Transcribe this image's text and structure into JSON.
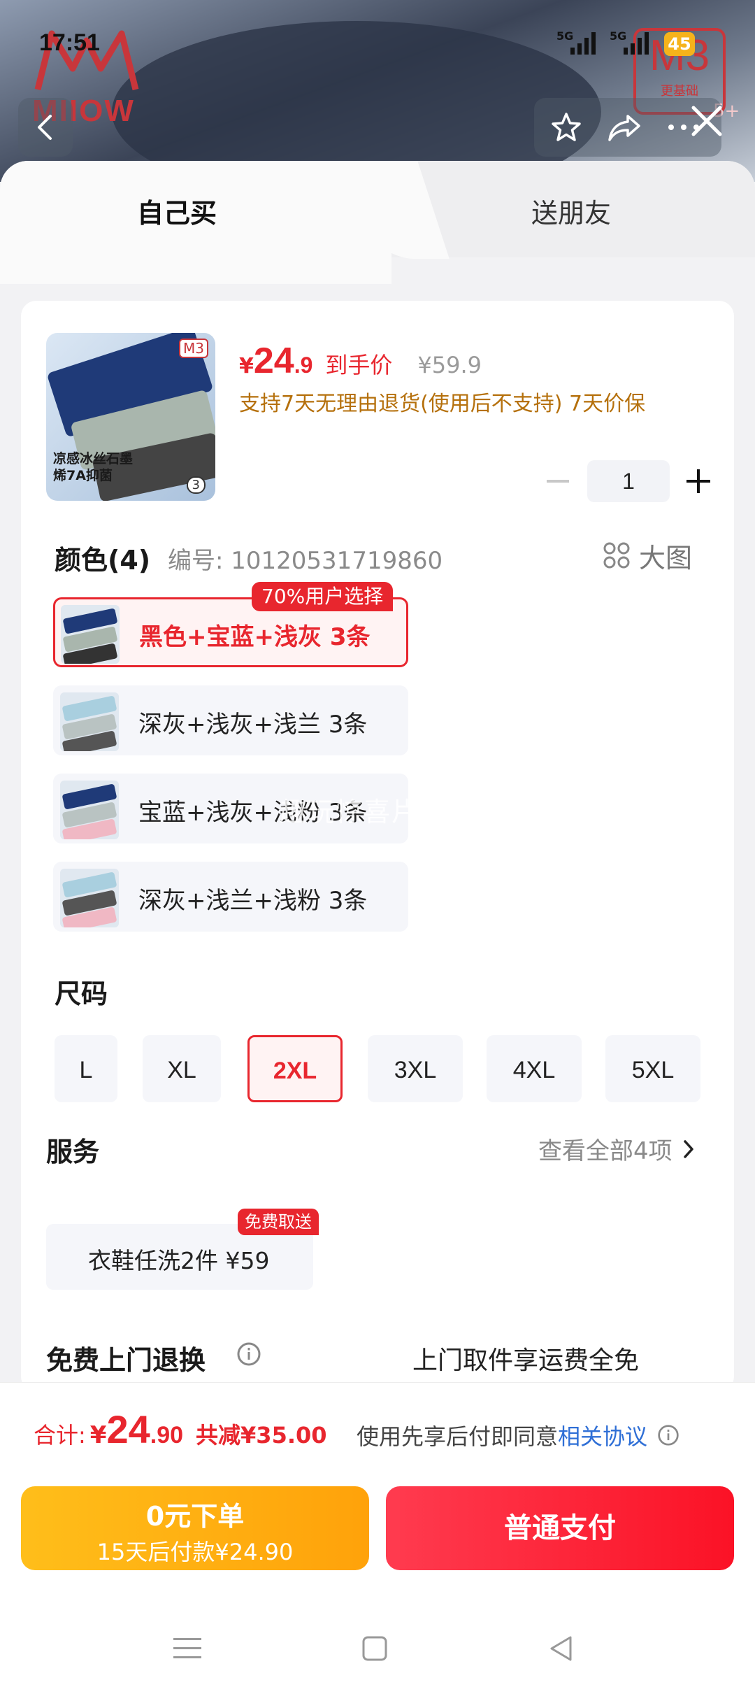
{
  "status_bar": {
    "time": "17:51",
    "signal1": "5G",
    "signal2": "5G",
    "battery": "45"
  },
  "overlay": {
    "brand": "MIIOW",
    "m3_badge": "M3",
    "m3_badge_sub": "更基础",
    "more_badge": "5+",
    "icons": [
      "back-icon",
      "star-icon",
      "share-icon",
      "more-icon",
      "close-icon"
    ]
  },
  "tabs": [
    {
      "label": "自己买",
      "active": true
    },
    {
      "label": "送朋友",
      "active": false
    }
  ],
  "product": {
    "thumb_caption": "凉感冰丝石墨烯7A抑菌",
    "thumb_badge": "M3",
    "thumb_count": "3",
    "price_currency": "¥",
    "price_int": "24",
    "price_dec": ".9",
    "price_label": "到手价",
    "original_price": "¥59.9",
    "promise": "支持7天无理由退货(使用后不支持) 7天价保",
    "quantity": "1"
  },
  "color_section": {
    "title": "颜色(4)",
    "code": "编号: 10120531719860",
    "big_image": "大图",
    "hot_tag": "70%用户选择",
    "options": [
      {
        "label": "黑色+宝蓝+浅灰 3条",
        "selected": true
      },
      {
        "label": "深灰+浅灰+浅兰 3条",
        "selected": false
      },
      {
        "label": "宝蓝+浅灰+浅粉 3条",
        "selected": false
      },
      {
        "label": "深灰+浅兰+浅粉 3条",
        "selected": false
      }
    ]
  },
  "watermark": "趣玩惊喜片",
  "size_section": {
    "title": "尺码",
    "options": [
      {
        "label": "L",
        "selected": false
      },
      {
        "label": "XL",
        "selected": false
      },
      {
        "label": "2XL",
        "selected": true
      },
      {
        "label": "3XL",
        "selected": false
      },
      {
        "label": "4XL",
        "selected": false
      },
      {
        "label": "5XL",
        "selected": false
      }
    ]
  },
  "service_section": {
    "title": "服务",
    "view_all": "查看全部4项",
    "badge": "免费取送",
    "item": "衣鞋任洗2件  ¥59"
  },
  "returns": {
    "title": "免费上门退换",
    "desc": "上门取件享运费全免"
  },
  "footer": {
    "total_label": "合计:",
    "total_currency": "¥",
    "total_int": "24",
    "total_dec": ".90",
    "saved": "共减¥35.00",
    "agree_text": "使用先享后付即同意",
    "agree_link": "相关协议",
    "btn_zero_line1": "0元下单",
    "btn_zero_line2": "15天后付款¥24.90",
    "btn_pay": "普通支付"
  },
  "colors": {
    "accent_red": "#e8262e",
    "promise_orange": "#b5700c",
    "pay_yellow": "#ffb012",
    "link_blue": "#2f6fd6"
  }
}
